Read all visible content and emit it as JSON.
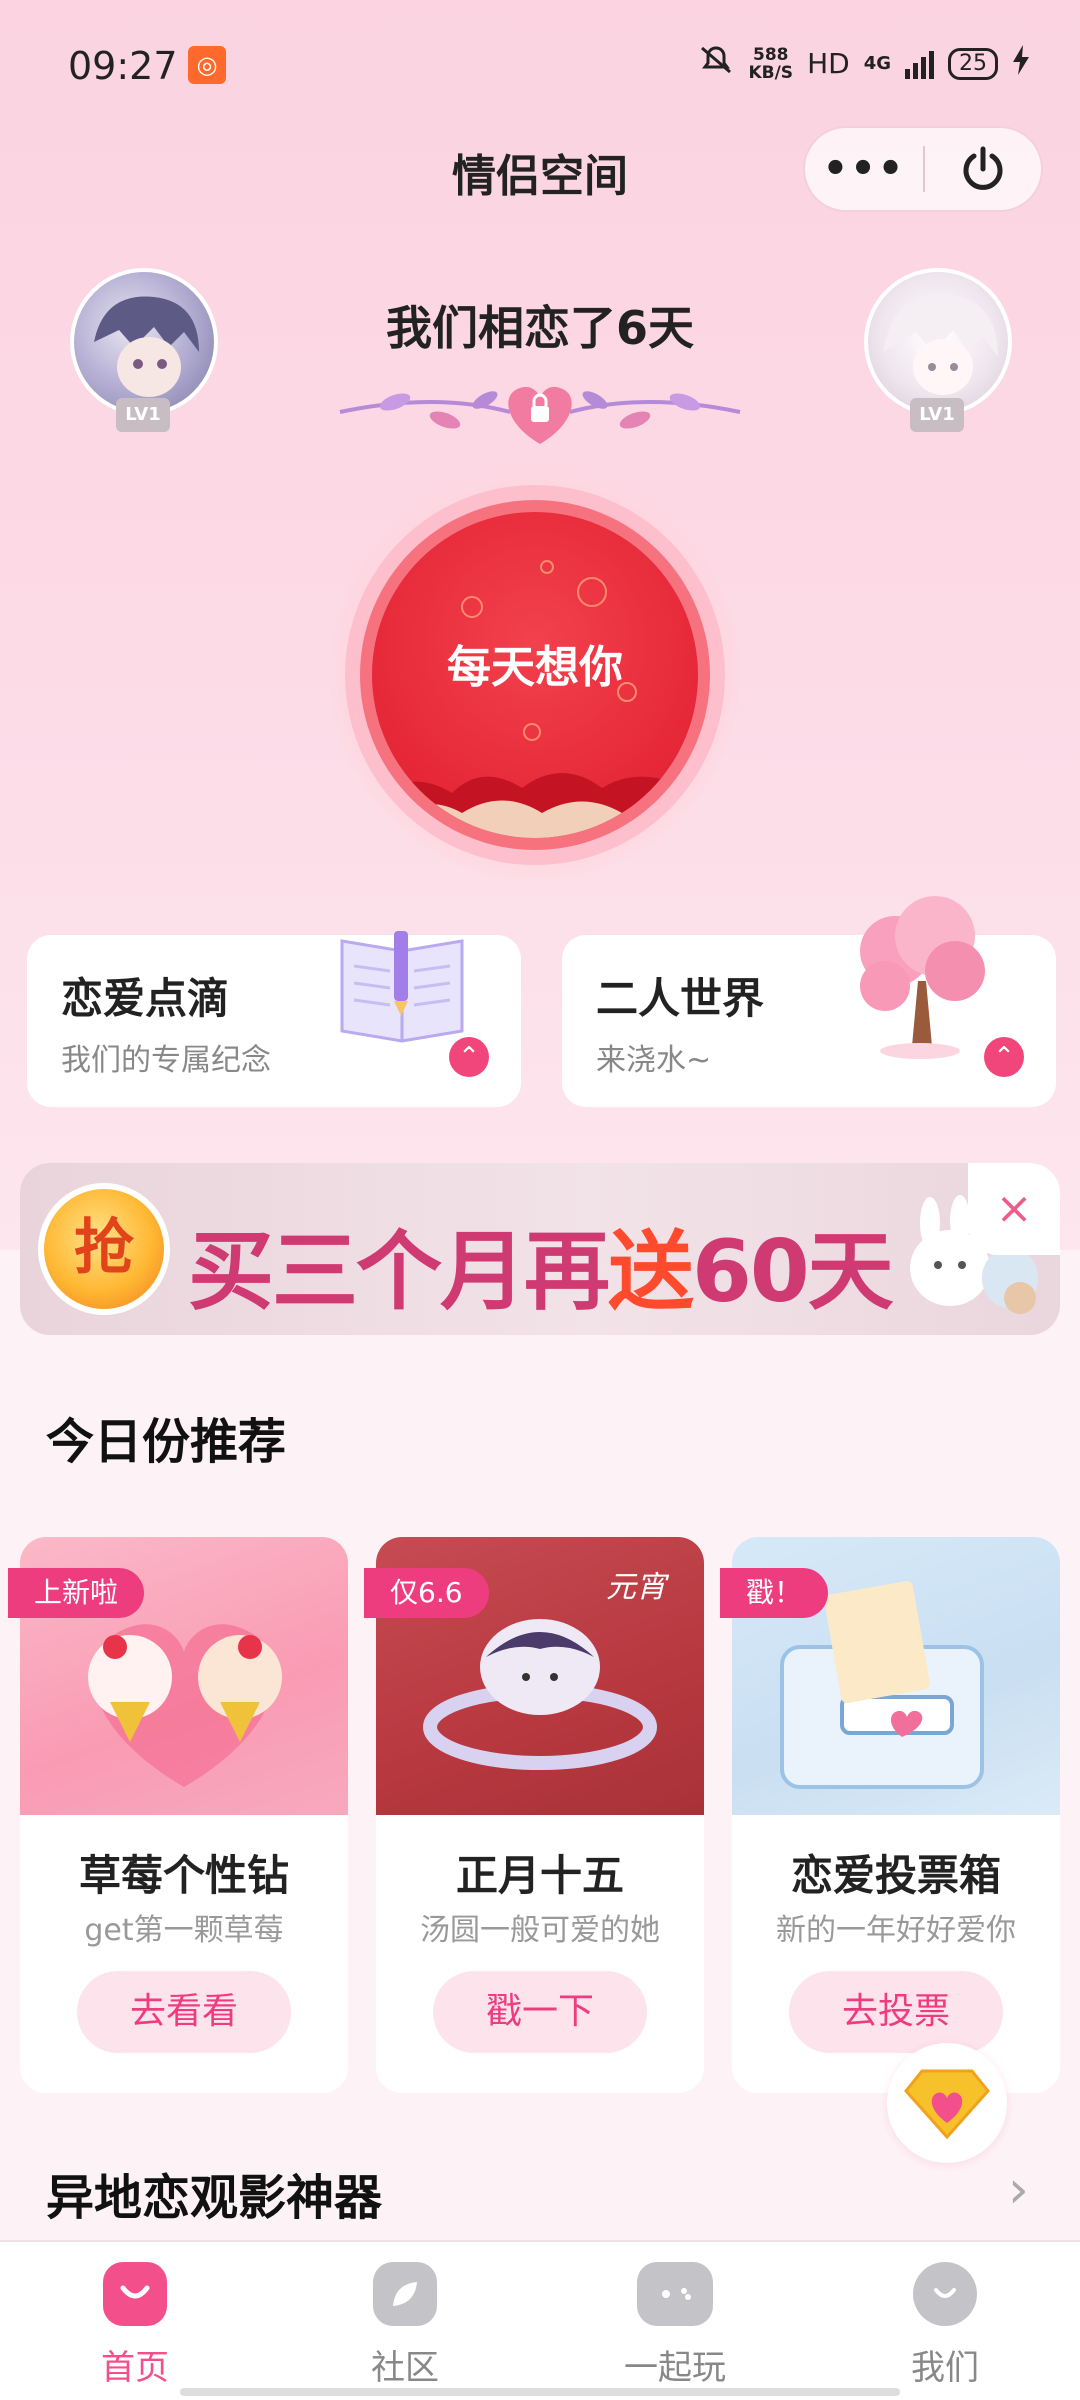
{
  "status_bar": {
    "time": "09:27",
    "speed_value": "588",
    "speed_unit": "KB/S",
    "hd": "HD",
    "network": "4G",
    "battery": "25"
  },
  "header": {
    "title": "情侣空间",
    "more_label": "•••"
  },
  "couple": {
    "left_level": "LV1",
    "right_level": "LV1",
    "days_text": "我们相恋了6天",
    "daily_button": "每天想你"
  },
  "cards": [
    {
      "title": "恋爱点滴",
      "subtitle": "我们的专属纪念"
    },
    {
      "title": "二人世界",
      "subtitle": "来浇水~"
    }
  ],
  "banner": {
    "badge": "抢",
    "text_pre": "买三个月再",
    "text_highlight": "送",
    "text_post": "60天",
    "close": "×"
  },
  "recommend": {
    "section_title": "今日份推荐",
    "items": [
      {
        "tag": "上新啦",
        "title": "草莓个性钻",
        "subtitle": "get第一颗草莓",
        "button": "去看看"
      },
      {
        "tag": "仅6.6",
        "title": "正月十五",
        "subtitle": "汤圆一般可爱的她",
        "button": "戳一下"
      },
      {
        "tag": "戳！",
        "title": "恋爱投票箱",
        "subtitle": "新的一年好好爱你",
        "button": "去投票"
      }
    ]
  },
  "section2": {
    "title": "异地恋观影神器",
    "arrow": "›"
  },
  "tabbar": [
    {
      "label": "首页",
      "active": true
    },
    {
      "label": "社区",
      "active": false
    },
    {
      "label": "一起玩",
      "active": false
    },
    {
      "label": "我们",
      "active": false
    }
  ],
  "colors": {
    "accent": "#f24f8b",
    "button_red": "#e52737",
    "background_pink": "#fbd3e1"
  }
}
